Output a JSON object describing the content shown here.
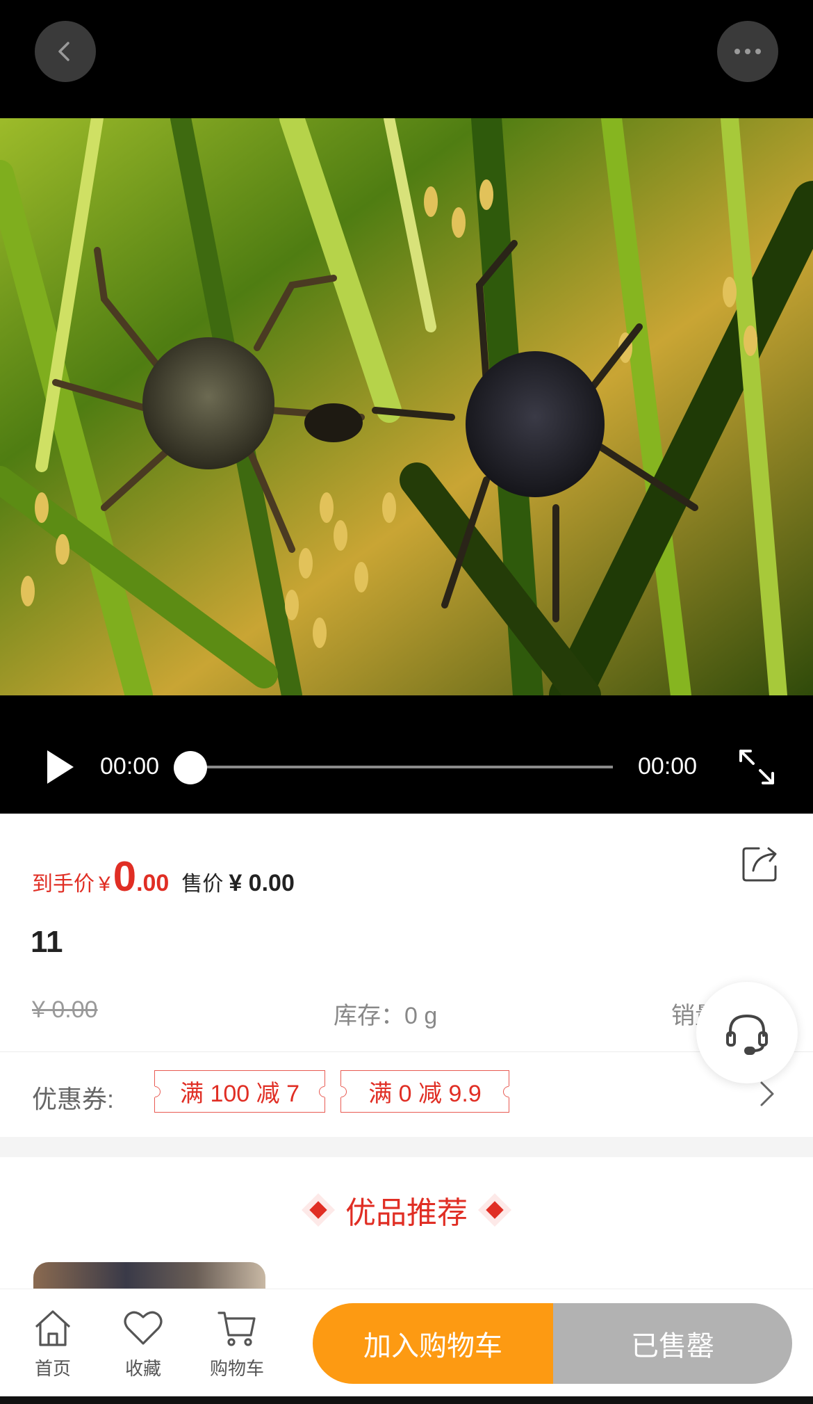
{
  "video": {
    "current_time": "00:00",
    "duration": "00:00",
    "progress": 0
  },
  "product": {
    "final_price_label": "到手价",
    "final_price_currency": "¥",
    "final_price_int": "0",
    "final_price_dec": ".00",
    "sale_price_label": "售价",
    "sale_price_value": "¥ 0.00",
    "title": "11",
    "original_price": "¥ 0.00",
    "stock": "库存：0 g",
    "sales": "销量"
  },
  "coupons": {
    "label": "优惠券:",
    "items": [
      "满 100 减 7",
      "满 0 减 9.9"
    ]
  },
  "recommend": {
    "title": "优品推荐"
  },
  "bottom_bar": {
    "home": "首页",
    "favorite": "收藏",
    "cart": "购物车",
    "add_to_cart": "加入购物车",
    "sold_out": "已售罄"
  },
  "colors": {
    "accent_red": "#e02e24",
    "cart_orange": "#fd9a12",
    "sold_gray": "#b2b2b2"
  },
  "icons": [
    "back-icon",
    "more-icon",
    "play-icon",
    "fullscreen-icon",
    "share-icon",
    "headset-icon",
    "chevron-right-icon",
    "home-icon",
    "heart-icon",
    "cart-icon"
  ]
}
